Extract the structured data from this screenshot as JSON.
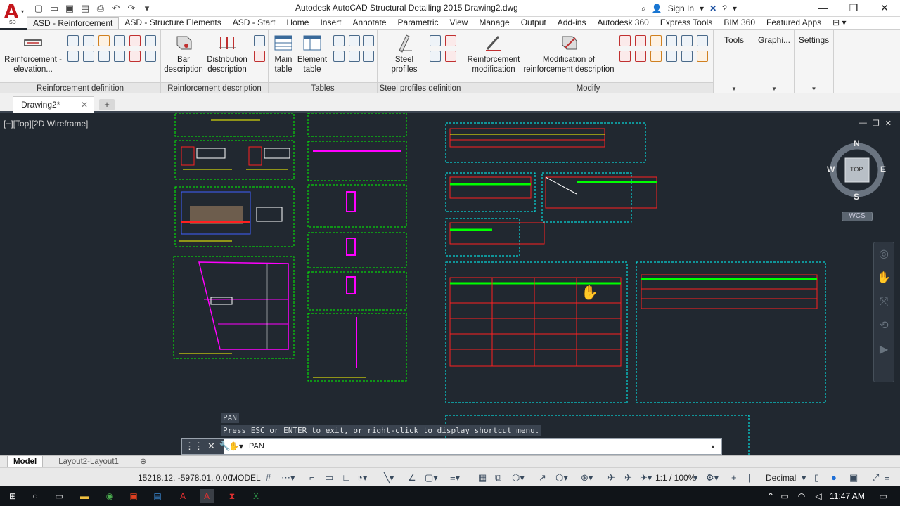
{
  "window": {
    "title": "Autodesk AutoCAD Structural Detailing 2015    Drawing2.dwg",
    "signin_label": "Sign In",
    "app_logo_text": "A",
    "app_logo_sub": "SD"
  },
  "ribbon_tabs": [
    "ASD - Reinforcement",
    "ASD - Structure Elements",
    "ASD - Start",
    "Home",
    "Insert",
    "Annotate",
    "Parametric",
    "View",
    "Manage",
    "Output",
    "Add-ins",
    "Autodesk 360",
    "Express Tools",
    "BIM 360",
    "Featured Apps"
  ],
  "ribbon": {
    "reinforcement_definition": {
      "title": "Reinforcement definition",
      "btn": "Reinforcement - elevation..."
    },
    "reinforcement_description": {
      "title": "Reinforcement description",
      "bar_description": "Bar description",
      "distribution_description": "Distribution description"
    },
    "tables": {
      "title": "Tables",
      "main_table": "Main table",
      "element_table": "Element table"
    },
    "steel_profiles": {
      "title": "Steel profiles definition",
      "steel_profiles": "Steel profiles"
    },
    "modify": {
      "title": "Modify",
      "reinforcement_modification": "Reinforcement modification",
      "modification_description": "Modification of reinforcement description"
    },
    "side": {
      "tools": "Tools",
      "graphics": "Graphi...",
      "settings": "Settings"
    }
  },
  "doc_tab": {
    "name": "Drawing2*"
  },
  "viewport": {
    "label": "[−][Top][2D Wireframe]",
    "cube_top": "TOP",
    "cube_n": "N",
    "cube_s": "S",
    "cube_e": "E",
    "cube_w": "W",
    "wcs": "WCS"
  },
  "command": {
    "tooltip_title": "PAN",
    "tooltip_text": "Press ESC or ENTER to exit, or right-click to display shortcut menu.",
    "prompt": "PAN"
  },
  "layout_tabs": [
    "Model",
    "Layout2-Layout1"
  ],
  "status": {
    "coords": "15218.12, -5978.01, 0.00",
    "space": "MODEL",
    "scale": "1:1 / 100%",
    "units": "Decimal"
  },
  "taskbar": {
    "time": "11:47 AM"
  },
  "colors": {
    "canvas": "#212830",
    "red": "#ff2020",
    "yellow": "#ffff00",
    "green": "#00ff00",
    "cyan": "#00ffff",
    "magenta": "#ff00ff"
  }
}
